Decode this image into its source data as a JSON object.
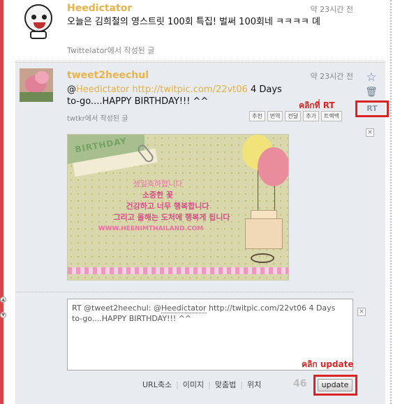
{
  "tweet1": {
    "username": "Heedictator",
    "time": "약 23시간 전",
    "text": "오늘은 김희철의 영스트릿 100회 특집! 벌써 100회네 ㅋㅋㅋㅋ 뎨",
    "via": "Twittelator에서 작성된 글"
  },
  "tweet2": {
    "username": "tweet2heechul",
    "time": "약 23시간 전",
    "text_prefix": "@",
    "mention": "Heedictator",
    "link": "http://twitpic.com/22vt06",
    "text_rest": " 4 Days to-go....HAPPY BIRTHDAY!!! ^^",
    "via": "twtkr에서 작성된 글",
    "actions": [
      "추천",
      "번역",
      "전달",
      "추가",
      "트랙백"
    ],
    "rt_label": "RT",
    "annotation_rt": "คลิกที่ RT"
  },
  "image": {
    "corner_text": "BIRTHDAY",
    "line1": "생일축하합니다",
    "line2": "소중한 꽃",
    "line3": "건강하고 너무 행복합니다",
    "line4": "그리고 올해는 도처에 행복게 됩니다",
    "url": "WWW.HEENIMTHAILAND.COM"
  },
  "reply": {
    "text_before": "RT @tweet2heechul: @",
    "mention": "Heedictator",
    "text_after": " http://twitpic.com/22vt06 4 Days to-go....HAPPY BIRTHDAY!!! ^^"
  },
  "toolbar": {
    "url_shorten": "URL축소",
    "image": "이미지",
    "spellcheck": "맞춤법",
    "location": "위치",
    "counter": "46",
    "update_label": "update",
    "annotation_update": "คลิก update"
  },
  "colors": {
    "username": "#e8b44a",
    "annotation": "#d82424",
    "panel_bg": "#e8ecf1"
  }
}
